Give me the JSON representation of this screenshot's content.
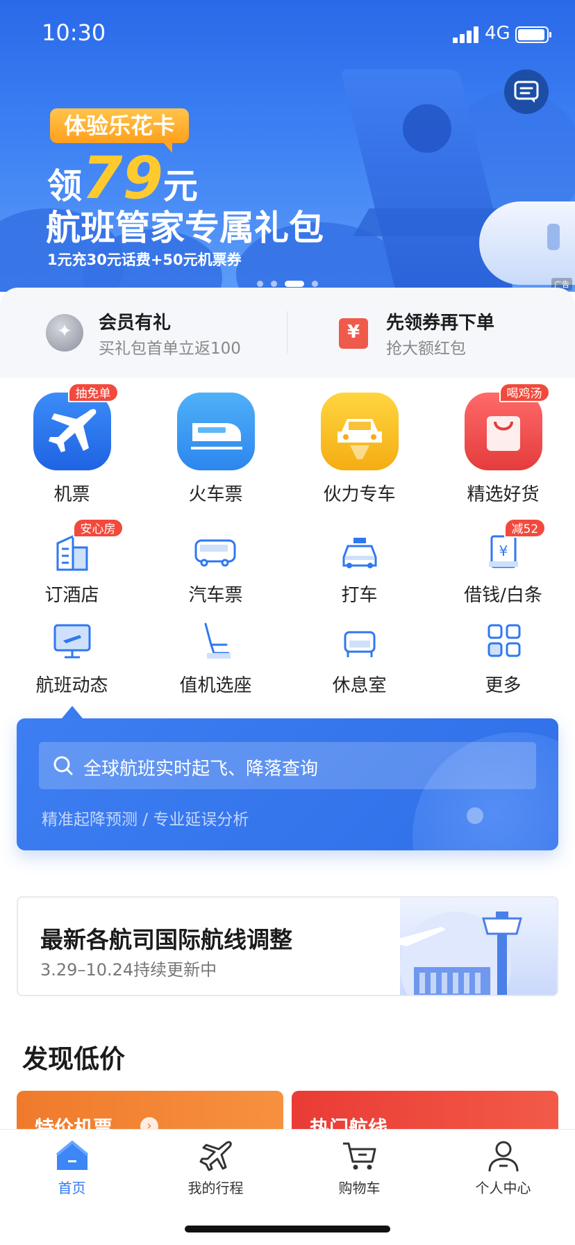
{
  "status_bar": {
    "time": "10:30",
    "network": "4G",
    "battery_percent": 100
  },
  "banner": {
    "tag": "体验乐花卡",
    "headline_prefix": "领",
    "headline_number": "79",
    "headline_suffix": "元",
    "headline2": "航班管家专属礼包",
    "subline": "1元充30元话费+50元机票券",
    "ad_label": "广告",
    "page_count": 4,
    "active_page": 3
  },
  "member": {
    "left": {
      "title": "会员有礼",
      "subtitle": "买礼包首单立返100",
      "icon": "✦"
    },
    "right": {
      "title": "先领券再下单",
      "subtitle": "抢大额红包",
      "icon": "¥"
    }
  },
  "services_primary": [
    {
      "label": "机票",
      "badge": "抽免单",
      "icon": "plane-icon"
    },
    {
      "label": "火车票",
      "badge": "",
      "icon": "train-icon"
    },
    {
      "label": "伙力专车",
      "badge": "",
      "icon": "car-icon"
    },
    {
      "label": "精选好货",
      "badge": "喝鸡汤",
      "icon": "shopping-bag-icon"
    }
  ],
  "services_secondary": [
    {
      "label": "订酒店",
      "badge": "安心房",
      "icon": "hotel-icon"
    },
    {
      "label": "汽车票",
      "badge": "",
      "icon": "bus-icon"
    },
    {
      "label": "打车",
      "badge": "",
      "icon": "taxi-icon"
    },
    {
      "label": "借钱/白条",
      "badge": "减52",
      "icon": "loan-icon"
    },
    {
      "label": "航班动态",
      "badge": "",
      "icon": "flight-status-icon"
    },
    {
      "label": "值机选座",
      "badge": "",
      "icon": "seat-icon"
    },
    {
      "label": "休息室",
      "badge": "",
      "icon": "lounge-icon"
    },
    {
      "label": "更多",
      "badge": "",
      "icon": "more-grid-icon"
    }
  ],
  "flight_search": {
    "placeholder": "全球航班实时起飞、降落查询",
    "hint": "精准起降预测 / 专业延误分析"
  },
  "notice": {
    "title": "最新各航司国际航线调整",
    "subtitle": "3.29–10.24持续更新中"
  },
  "discover": {
    "title": "发现低价",
    "cards": [
      {
        "label": "特价机票"
      },
      {
        "label": "热门航线"
      }
    ]
  },
  "tabbar": [
    {
      "label": "首页",
      "icon": "home-icon",
      "active": true
    },
    {
      "label": "我的行程",
      "icon": "plane-outline-icon",
      "active": false
    },
    {
      "label": "购物车",
      "icon": "cart-icon",
      "active": false
    },
    {
      "label": "个人中心",
      "icon": "user-icon",
      "active": false
    }
  ],
  "colors": {
    "accent": "#2f78f0",
    "badge": "#f14a3d",
    "banner": "#3f82f4"
  }
}
